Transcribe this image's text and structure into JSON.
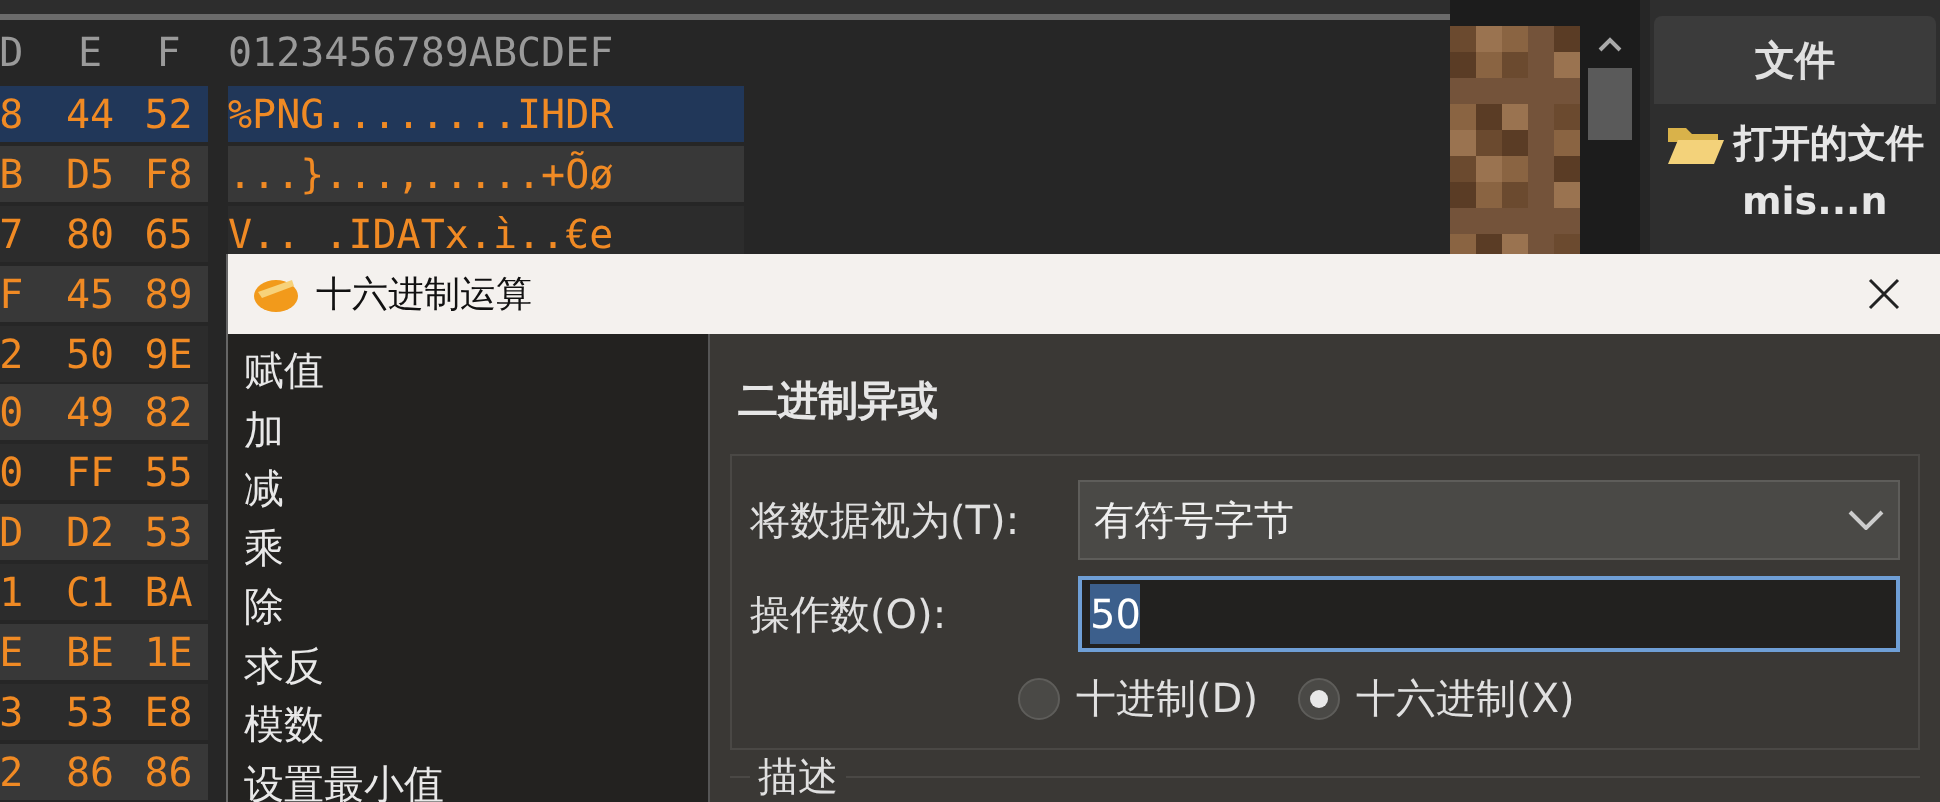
{
  "hex_view": {
    "columns": [
      "D",
      "E",
      "F"
    ],
    "ascii_header": "0123456789ABCDEF",
    "rows": [
      {
        "cells": [
          "8",
          "44",
          "52"
        ],
        "ascii": "%PNG........IHDR",
        "selected": true
      },
      {
        "cells": [
          "B",
          "D5",
          "F8"
        ],
        "ascii": "...}...,.....+Õø",
        "selected": false
      },
      {
        "cells": [
          "7",
          "80",
          "65"
        ],
        "ascii": "V.. .IDATx.ì..€e",
        "selected": false
      },
      {
        "cells": [
          "F",
          "45",
          "89"
        ],
        "selected": false
      },
      {
        "cells": [
          "2",
          "50",
          "9E"
        ],
        "selected": false
      },
      {
        "cells": [
          "0",
          "49",
          "82"
        ],
        "selected": false
      },
      {
        "cells": [
          "0",
          "FF",
          "55"
        ],
        "selected": false
      },
      {
        "cells": [
          "D",
          "D2",
          "53"
        ],
        "selected": false
      },
      {
        "cells": [
          "1",
          "C1",
          "BA"
        ],
        "selected": false
      },
      {
        "cells": [
          "E",
          "BE",
          "1E"
        ],
        "selected": false
      },
      {
        "cells": [
          "3",
          "53",
          "E8"
        ],
        "selected": false
      },
      {
        "cells": [
          "2",
          "86",
          "86"
        ],
        "selected": false
      }
    ]
  },
  "side_panel": {
    "title": "文件",
    "items": [
      {
        "label": "打开的文件",
        "children": [
          {
            "label": "mis...n"
          }
        ]
      }
    ]
  },
  "dialog": {
    "title": "十六进制运算",
    "operations": [
      "赋值",
      "加",
      "减",
      "乘",
      "除",
      "求反",
      "模数",
      "设置最小值"
    ],
    "heading": "二进制异或",
    "view_as": {
      "label": "将数据视为(T):",
      "value": "有符号字节"
    },
    "operand": {
      "label": "操作数(O):",
      "value": "50"
    },
    "radios": [
      {
        "label": "十进制(D)",
        "selected": false
      },
      {
        "label": "十六进制(X)",
        "selected": true
      }
    ],
    "group_label": "描述"
  }
}
